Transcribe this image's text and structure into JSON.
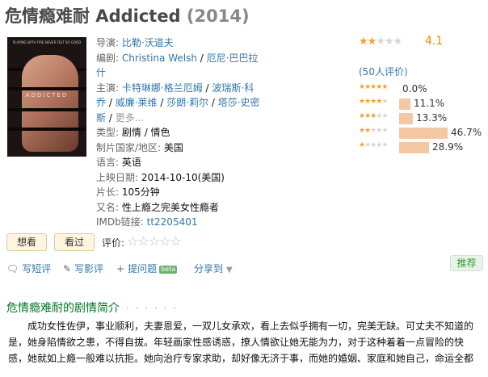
{
  "title": {
    "name": "危情瘾难耐 Addicted",
    "year": "(2014)"
  },
  "poster": {
    "tiny_text": "PLAYING WITH FIRE NEVER FELT SO GOOD",
    "word": "ADDICTED"
  },
  "info": {
    "director_label": "导演:",
    "director": "比勒·沃道夫",
    "writer_label": "编剧:",
    "writers": [
      "Christina Welsh",
      "厄尼·巴巴拉什"
    ],
    "cast_label": "主演:",
    "cast": [
      "卡特琳娜·格兰厄姆",
      "波瑞斯·科乔",
      "威廉·莱维",
      "莎朗·莉尔",
      "塔莎·史密斯"
    ],
    "cast_more": "更多...",
    "genre_label": "类型:",
    "genres": "剧情 / 情色",
    "country_label": "制片国家/地区:",
    "country": "美国",
    "language_label": "语言:",
    "language": "英语",
    "release_label": "上映日期:",
    "release": "2014-10-10(美国)",
    "runtime_label": "片长:",
    "runtime": "105分钟",
    "aka_label": "又名:",
    "aka": "性上瘾之完美女性瘾者",
    "imdb_label": "IMDb链接:",
    "imdb": "tt2205401"
  },
  "rating": {
    "score": "4.1",
    "stars_filled": 2,
    "count_text": "(50人评价)",
    "distribution": [
      {
        "stars": 5,
        "pct_value": 0.0,
        "pct": "0.0%"
      },
      {
        "stars": 4,
        "pct_value": 11.1,
        "pct": "11.1%"
      },
      {
        "stars": 3,
        "pct_value": 13.3,
        "pct": "13.3%"
      },
      {
        "stars": 2,
        "pct_value": 46.7,
        "pct": "46.7%"
      },
      {
        "stars": 1,
        "pct_value": 28.9,
        "pct": "28.9%"
      }
    ],
    "colors": {
      "bar": "#f5c8a4",
      "star": "#f6a02e",
      "score": "#e09015"
    }
  },
  "actions": {
    "want": "想看",
    "seen": "看过",
    "rate_label": "评价:",
    "rate_stars": "☆☆☆☆☆"
  },
  "links": {
    "short_review": "写短评",
    "review": "写影评",
    "ask": "提问题",
    "beta": "beta",
    "share": "分享到",
    "recommend": "推荐"
  },
  "intro": {
    "heading": "危情瘾难耐的剧情简介",
    "dots": "· · · · · ·",
    "text": "成功女性佐伊，事业顺利，夫妻恩爱，一双儿女承欢，看上去似乎拥有一切，完美无缺。可丈夫不知道的是，她身陷情欲之患，不得自拔。年轻画家性感诱惑，撩人情欲让她无能为力，对于这种着着一点冒险的快感，她就如上瘾一般难以抗拒。她向治疗专家求助，却好像无济于事，而她的婚姻、家庭和她自己，命运全都悬于一线"
  }
}
